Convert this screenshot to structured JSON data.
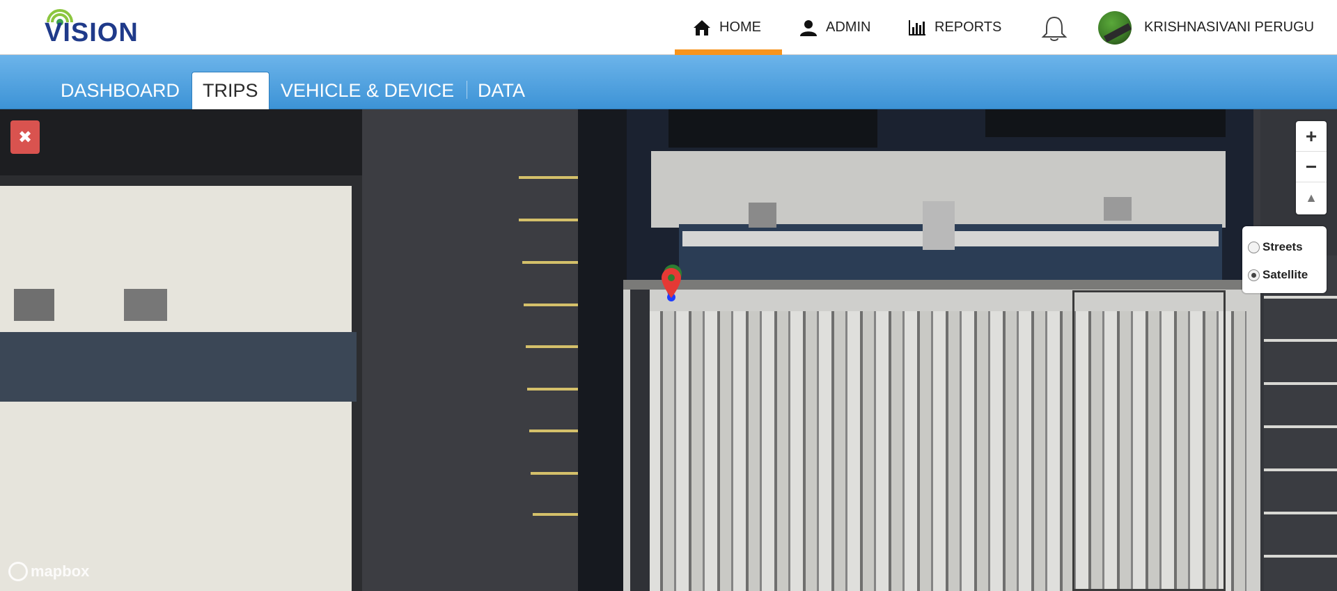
{
  "header": {
    "logo_text": "VISION",
    "nav": [
      {
        "label": "HOME",
        "icon": "home-icon",
        "active": true
      },
      {
        "label": "ADMIN",
        "icon": "user-icon",
        "active": false
      },
      {
        "label": "REPORTS",
        "icon": "bar-chart-icon",
        "active": false
      }
    ],
    "user_name": "KRISHNASIVANI PERUGU"
  },
  "subnav": {
    "tabs": [
      {
        "label": "DASHBOARD",
        "active": false
      },
      {
        "label": "TRIPS",
        "active": true
      },
      {
        "label": "VEHICLE & DEVICE",
        "active": false
      },
      {
        "label": "DATA",
        "active": false
      }
    ]
  },
  "map": {
    "close_symbol": "✖",
    "zoom_in": "+",
    "zoom_out": "−",
    "compass": "▲",
    "styles": [
      {
        "label": "Streets",
        "selected": false
      },
      {
        "label": "Satellite",
        "selected": true
      }
    ],
    "attribution": "mapbox"
  },
  "colors": {
    "accent": "#f7941d",
    "subnav": "#4a9fdf",
    "marker_red": "#e53935",
    "marker_green": "#2e7d32",
    "route_blue": "#1e3cff",
    "close_button": "#d9534f"
  }
}
